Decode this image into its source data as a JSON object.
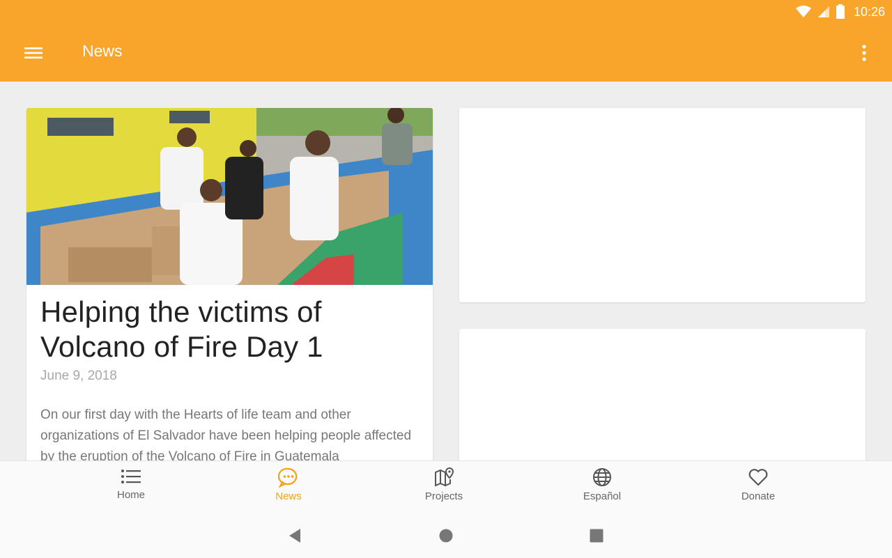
{
  "status_bar": {
    "time": "10:26"
  },
  "app_bar": {
    "title": "News"
  },
  "colors": {
    "accent": "#f9a52b",
    "active_nav": "#f4a11d"
  },
  "feed": {
    "featured": {
      "title": "Helping the victims of Volcano of Fire Day 1",
      "date": "June 9, 2018",
      "excerpt": "On our first day with the Hearts of life team and other organizations of El Salvador have been helping people affected by the eruption of the Volcano of Fire in Guatemala"
    }
  },
  "bottom_nav": {
    "items": [
      {
        "label": "Home",
        "icon": "list-icon"
      },
      {
        "label": "News",
        "icon": "chat-bubble-icon",
        "active": true
      },
      {
        "label": "Projects",
        "icon": "map-pin-icon"
      },
      {
        "label": "Español",
        "icon": "globe-icon"
      },
      {
        "label": "Donate",
        "icon": "heart-icon"
      }
    ]
  }
}
